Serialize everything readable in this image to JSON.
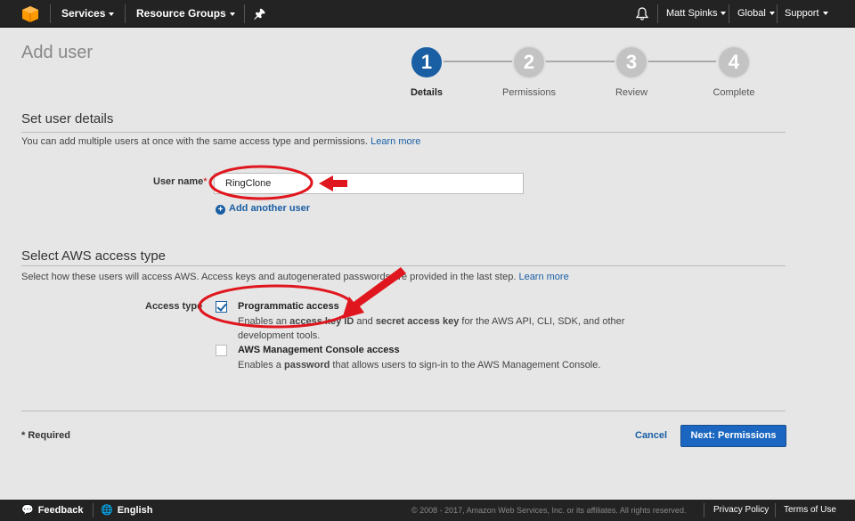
{
  "nav": {
    "services": "Services",
    "resource_groups": "Resource Groups",
    "user": "Matt Spinks",
    "region": "Global",
    "support": "Support"
  },
  "page": {
    "title": "Add user"
  },
  "stepper": {
    "steps": [
      {
        "number": "1",
        "label": "Details",
        "active": true
      },
      {
        "number": "2",
        "label": "Permissions",
        "active": false
      },
      {
        "number": "3",
        "label": "Review",
        "active": false
      },
      {
        "number": "4",
        "label": "Complete",
        "active": false
      }
    ]
  },
  "details": {
    "heading": "Set user details",
    "description": "You can add multiple users at once with the same access type and permissions.",
    "learn_more": "Learn more",
    "username_label": "User name",
    "required_mark": "*",
    "username_value": "RingClone",
    "add_another": "Add another user"
  },
  "access": {
    "heading": "Select AWS access type",
    "description": "Select how these users will access AWS. Access keys and autogenerated passwords are provided in the last step.",
    "learn_more": "Learn more",
    "label": "Access type",
    "options": [
      {
        "title": "Programmatic access",
        "checked": true,
        "desc_1": "Enables an ",
        "bold_1": "access key ID",
        "desc_2": " and ",
        "bold_2": "secret access key",
        "desc_3": " for the AWS API, CLI, SDK, and other development tools."
      },
      {
        "title": "AWS Management Console access",
        "checked": false,
        "desc_1": "Enables a ",
        "bold_1": "password",
        "desc_2": " that allows users to sign-in to the AWS Management Console."
      }
    ]
  },
  "actions": {
    "required_note": "* Required",
    "cancel": "Cancel",
    "next": "Next: Permissions"
  },
  "footer": {
    "feedback": "Feedback",
    "language": "English",
    "copyright": "© 2008 - 2017, Amazon Web Services, Inc. or its affiliates. All rights reserved.",
    "privacy": "Privacy Policy",
    "terms": "Terms of Use"
  },
  "colors": {
    "accent": "#1a5fa4",
    "annotation": "#e0161e",
    "nav_bg": "#232323"
  }
}
